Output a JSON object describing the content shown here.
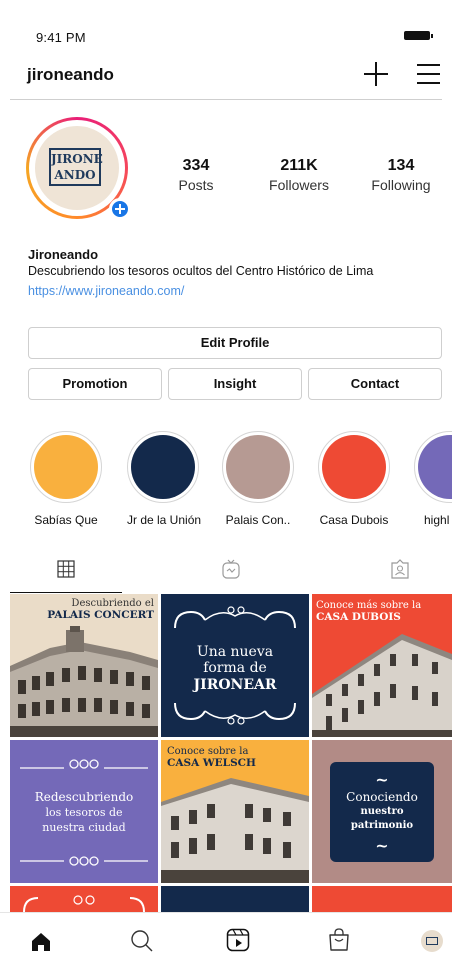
{
  "status_bar": {
    "time": "9:41 PM"
  },
  "header": {
    "username": "jironeando"
  },
  "profile": {
    "avatar_logo_line1": "JIRONE",
    "avatar_logo_line2": "ANDO",
    "stats": [
      {
        "value": "334",
        "label": "Posts"
      },
      {
        "value": "211K",
        "label": "Followers"
      },
      {
        "value": "134",
        "label": "Following"
      }
    ],
    "name": "Jironeando",
    "bio": "Descubriendo los tesoros ocultos del Centro Histórico de Lima",
    "link": "https://www.jironeando.com/"
  },
  "buttons": {
    "edit_profile": "Edit Profile",
    "promotion": "Promotion",
    "insight": "Insight",
    "contact": "Contact"
  },
  "highlights": [
    {
      "label": "Sabías Que",
      "color": "#f9b03e"
    },
    {
      "label": "Jr de la Unión",
      "color": "#13294b"
    },
    {
      "label": "Palais Con..",
      "color": "#b69a93"
    },
    {
      "label": "Casa Dubois",
      "color": "#ee4a34"
    },
    {
      "label": "highl",
      "color": "#7469b8"
    }
  ],
  "posts": [
    {
      "line1": "Descubriendo el",
      "line2": "PALAIS CONCERT"
    },
    {
      "line1": "Una nueva",
      "line2": "forma de",
      "line3": "JIRONEAR"
    },
    {
      "line1": "Conoce más sobre la",
      "line2": "CASA DUBOIS"
    },
    {
      "line1": "Redescubriendo",
      "line2": "los tesoros de",
      "line3": "nuestra ciudad"
    },
    {
      "line1": "Conoce sobre la",
      "line2": "CASA WELSCH"
    },
    {
      "line1": "Conociendo",
      "line2": "nuestro",
      "line3": "patrimonio"
    }
  ],
  "colors": {
    "navy": "#13294b",
    "orange": "#f9b03e",
    "red": "#ee4a34",
    "purple": "#7469b8",
    "mauve": "#b28b86",
    "link": "#4a90e2",
    "badge": "#1976e6"
  },
  "icons": [
    "plus-icon",
    "menu-icon",
    "grid-icon",
    "igtv-icon",
    "tagged-icon",
    "home-icon",
    "search-icon",
    "reels-icon",
    "shop-icon",
    "profile-avatar-icon"
  ]
}
